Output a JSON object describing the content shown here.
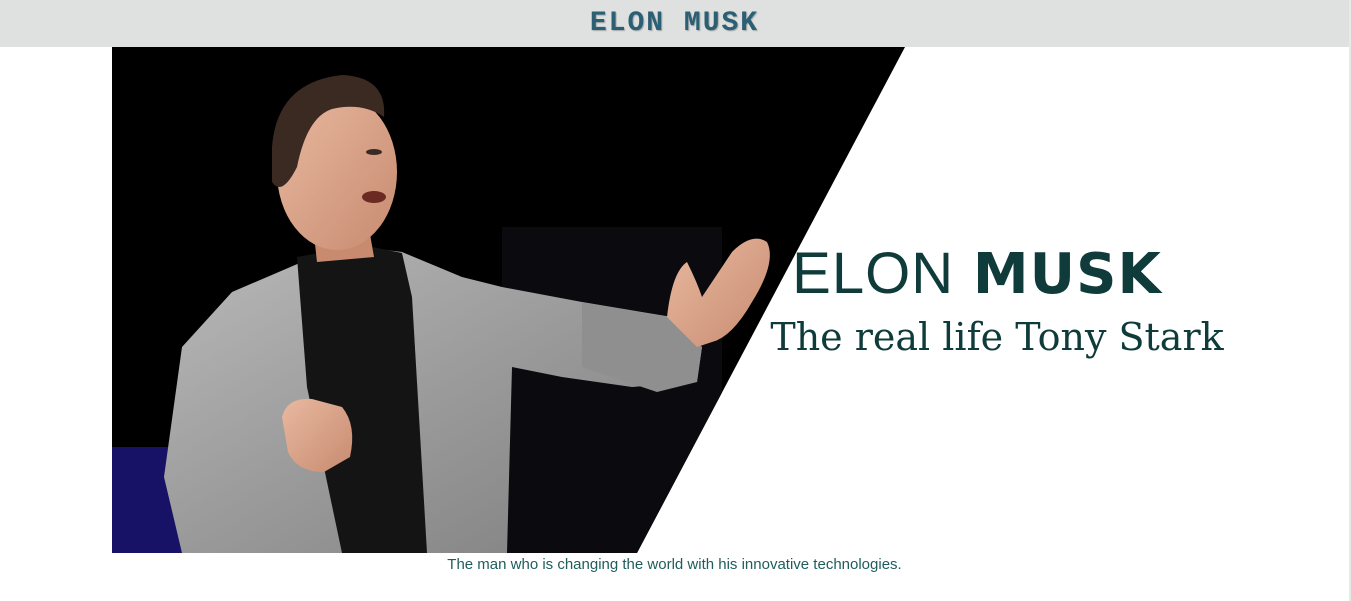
{
  "header": {
    "title": "ELON MUSK"
  },
  "hero": {
    "name_light": "ELON",
    "name_bold": "MUSK",
    "tagline": "The real life Tony Stark",
    "photo_icon": "person-photo"
  },
  "caption": {
    "text": "The man who is changing the world with his innovative technologies."
  },
  "colors": {
    "header_bg": "#dfe0e0",
    "header_text": "#2b5f73",
    "hero_text": "#0f3b3a",
    "caption_text": "#1f5d5d"
  }
}
